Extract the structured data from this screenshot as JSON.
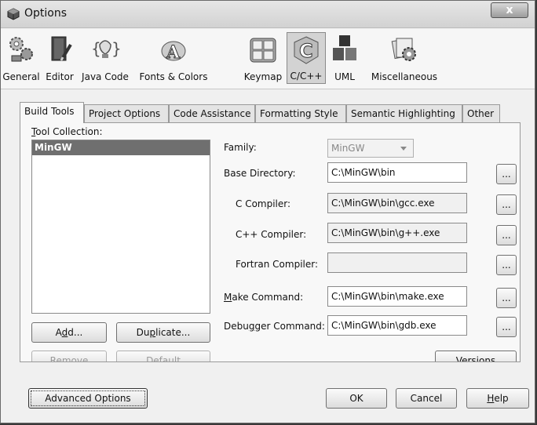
{
  "window": {
    "title": "Options",
    "close_glyph": "x"
  },
  "categories": [
    {
      "label": "General",
      "icon": "gears-icon"
    },
    {
      "label": "Editor",
      "icon": "book-pen-icon"
    },
    {
      "label": "Java Code",
      "icon": "java-coffee-icon"
    },
    {
      "label": "Fonts & Colors",
      "icon": "font-palette-icon"
    },
    {
      "label": "Keymap",
      "icon": "keyboard-icon"
    },
    {
      "label": "C/C++",
      "icon": "c-language-icon",
      "selected": true
    },
    {
      "label": "UML",
      "icon": "uml-blocks-icon"
    },
    {
      "label": "Miscellaneous",
      "icon": "misc-gear-icon"
    }
  ],
  "tabs": [
    {
      "label": "Build Tools",
      "selected": true
    },
    {
      "label": "Project Options"
    },
    {
      "label": "Code Assistance"
    },
    {
      "label": "Formatting Style"
    },
    {
      "label": "Semantic Highlighting"
    },
    {
      "label": "Other"
    }
  ],
  "tool_collection": {
    "label_mnemonic": "T",
    "label_rest": "ool Collection:",
    "items": [
      "MinGW"
    ]
  },
  "buttons": {
    "add_pre": "A",
    "add_mn": "d",
    "add_post": "d...",
    "dup_pre": "Du",
    "dup_mn": "p",
    "dup_post": "licate...",
    "remove": "Remove",
    "default": "Default",
    "versions": "Versions",
    "dots": "...",
    "advanced": "Advanced Options",
    "ok": "OK",
    "cancel": "Cancel",
    "help_mn": "H",
    "help_rest": "elp"
  },
  "fields": {
    "family_label": "Family:",
    "family_value": "MinGW",
    "base_dir_label": "Base Directory:",
    "base_dir_value": "C:\\MinGW\\bin",
    "c_compiler_label": "C Compiler:",
    "c_compiler_value": "C:\\MinGW\\bin\\gcc.exe",
    "cpp_compiler_label": "C++ Compiler:",
    "cpp_compiler_value": "C:\\MinGW\\bin\\g++.exe",
    "fortran_label": "Fortran Compiler:",
    "fortran_value": "",
    "make_label_mn": "M",
    "make_label_rest": "ake Command:",
    "make_value": "C:\\MinGW\\bin\\make.exe",
    "debugger_label_pre": "Debu",
    "debugger_label_mn": "g",
    "debugger_label_post": "ger Command:",
    "debugger_value": "C:\\MinGW\\bin\\gdb.exe"
  }
}
